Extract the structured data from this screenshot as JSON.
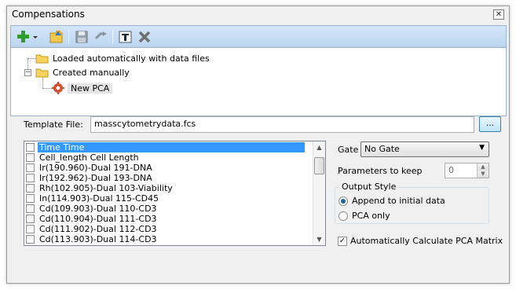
{
  "window": {
    "title": "Compensations",
    "close_glyph": "✕"
  },
  "toolbar": {
    "items": [
      {
        "name": "add-button",
        "icon": "plus-icon"
      },
      {
        "name": "add-dropdown-button",
        "icon": "dropdown-arrow-icon"
      },
      {
        "name": "import-button",
        "icon": "folder-up-icon"
      },
      {
        "name": "save-button",
        "icon": "floppy-disk-icon"
      },
      {
        "name": "link-button",
        "icon": "link-icon"
      },
      {
        "name": "rename-button",
        "icon": "text-edit-icon"
      },
      {
        "name": "delete-button",
        "icon": "x-icon"
      }
    ]
  },
  "tree": {
    "nodes": [
      {
        "label": "Loaded automatically with data files",
        "icon": "folder-icon",
        "expander": ""
      },
      {
        "label": "Created manually",
        "icon": "folder-icon",
        "expander": "−"
      },
      {
        "label": "New PCA",
        "icon": "gear-icon",
        "selected": true
      }
    ]
  },
  "template": {
    "label": "Template File:",
    "value": "masscytometrydata.fcs",
    "browse_label": "..."
  },
  "parameters": {
    "items": [
      {
        "label": "Time Time",
        "checked": false,
        "selected": true
      },
      {
        "label": "Cell_length Cell Length",
        "checked": false
      },
      {
        "label": "Ir(190.960)-Dual 191-DNA",
        "checked": false
      },
      {
        "label": "Ir(192.962)-Dual 193-DNA",
        "checked": false
      },
      {
        "label": "Rh(102.905)-Dual 103-Viability",
        "checked": false
      },
      {
        "label": "In(114.903)-Dual 115-CD45",
        "checked": false
      },
      {
        "label": "Cd(109.903)-Dual 110-CD3",
        "checked": false
      },
      {
        "label": "Cd(110.904)-Dual 111-CD3",
        "checked": false
      },
      {
        "label": "Cd(111.902)-Dual 112-CD3",
        "checked": false
      },
      {
        "label": "Cd(113.903)-Dual 114-CD3",
        "checked": false
      }
    ]
  },
  "gate": {
    "label": "Gate",
    "value": "No Gate"
  },
  "keep": {
    "label": "Parameters to keep",
    "value": "0"
  },
  "output_style": {
    "title": "Output Style",
    "options": [
      {
        "label": "Append to initial data",
        "selected": true
      },
      {
        "label": "PCA only",
        "selected": false
      }
    ]
  },
  "auto_calc": {
    "label": "Automatically Calculate PCA Matrix",
    "checked": true,
    "check_glyph": "✓"
  },
  "colors": {
    "toolbar_top": "#d4e6f9",
    "selection": "#3399ff",
    "add_green": "#2e9d2e",
    "delete_gray": "#707070"
  }
}
